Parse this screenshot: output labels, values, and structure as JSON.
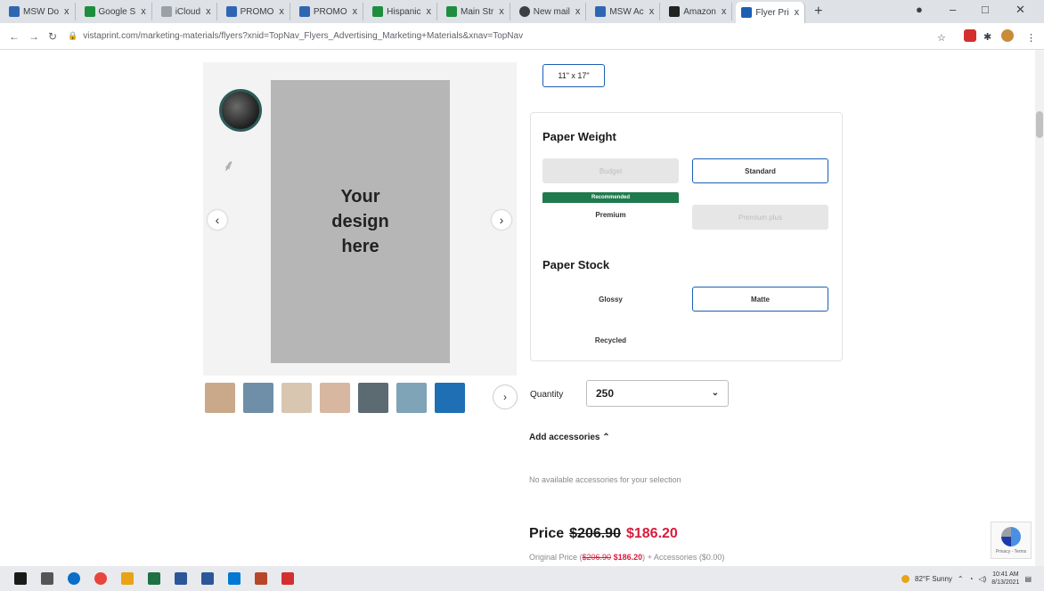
{
  "browser": {
    "tabs": [
      {
        "label": "MSW Do",
        "color": "#2f66b3"
      },
      {
        "label": "Google S",
        "color": "#1e8e3e"
      },
      {
        "label": "iCloud",
        "color": "#9aa0a6"
      },
      {
        "label": "PROMO",
        "color": "#2f66b3"
      },
      {
        "label": "PROMO",
        "color": "#2f66b3"
      },
      {
        "label": "Hispanic",
        "color": "#1e8e3e"
      },
      {
        "label": "Main Str",
        "color": "#1e8e3e"
      },
      {
        "label": "New mail",
        "color": "#3c4043"
      },
      {
        "label": "MSW Ac",
        "color": "#2f66b3"
      },
      {
        "label": "Amazon",
        "color": "#222222"
      },
      {
        "label": "Flyer Pri",
        "color": "#1a5fb4"
      }
    ],
    "new_tab_glyph": "+",
    "close_glyph": "x",
    "url": "vistaprint.com/marketing-materials/flyers?xnid=TopNav_Flyers_Advertising_Marketing+Materials&xnav=TopNav"
  },
  "preview": {
    "flyer_text_1": "Your",
    "flyer_text_2": "design",
    "flyer_text_3": "here",
    "prev_glyph": "‹",
    "next_glyph": "›",
    "thumb_next_glyph": "›"
  },
  "thumbnail_colors": [
    "#c9a98a",
    "#6f8fa8",
    "#d9c6b0",
    "#d7b7a0",
    "#5c6a72",
    "#7fa3b7",
    "#1f6fb5"
  ],
  "size_option": "11\" x 17\"",
  "paper_weight": {
    "heading": "Paper Weight",
    "options": {
      "budget": "Budget",
      "standard": "Standard",
      "premium": "Premium",
      "premium_plus": "Premium plus"
    },
    "recommended_badge": "Recommended"
  },
  "paper_stock": {
    "heading": "Paper Stock",
    "options": {
      "glossy": "Glossy",
      "matte": "Matte",
      "recycled": "Recycled"
    }
  },
  "quantity": {
    "label": "Quantity",
    "value": "250"
  },
  "accessories": {
    "toggle_label": "Add accessories",
    "toggle_glyph": "⌃",
    "empty_text": "No available accessories for your selection"
  },
  "pricing": {
    "label": "Price",
    "original": "$206.90",
    "sale": "$186.20",
    "note_prefix": "Original Price (",
    "note_original": "$206.90",
    "note_sale": "$186.20",
    "note_suffix": ") + Accessories ($0.00)"
  },
  "recaptcha_text": "Privacy - Terms",
  "taskbar": {
    "icon_colors": [
      "#1a1a1a",
      "#555555",
      "#0b6ec9",
      "#e8453c",
      "#e8a317",
      "#1e7145",
      "#2b579a",
      "#2b579a",
      "#0078d4",
      "#b7472a",
      "#d32f2f"
    ],
    "weather": "82°F Sunny",
    "time": "10:41 AM",
    "date": "8/13/2021"
  }
}
